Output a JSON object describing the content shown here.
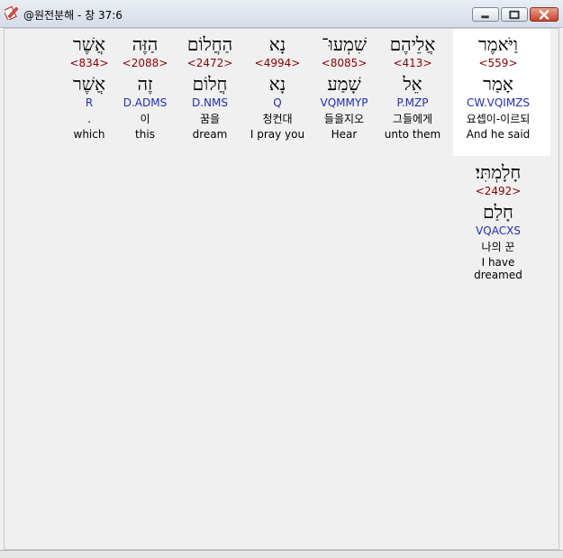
{
  "window": {
    "title": "@원전분해 - 창 37:6",
    "icon": "app-icon",
    "buttons": [
      "minimize",
      "maximize",
      "close"
    ]
  },
  "colors": {
    "strong": "#8b0000",
    "morph": "#1f2fb0",
    "highlight": "#ffffff"
  },
  "words": [
    {
      "heb": "וַיֹּאמֶר",
      "strong": "<559>",
      "lemma": "אָמַר",
      "morph": "CW.VQIMZS",
      "kor": "요셉이-이르되",
      "eng": "And he said"
    },
    {
      "heb": "אֲלֵיהֶם",
      "strong": "<413>",
      "lemma": "אֵל",
      "morph": "P.MZP",
      "kor": "그들에게",
      "eng": "unto them"
    },
    {
      "heb": "שִׁמְעוּ־",
      "strong": "<8085>",
      "lemma": "שָׁמַע",
      "morph": "VQMMYP",
      "kor": "들을지오",
      "eng": "Hear"
    },
    {
      "heb": "נָא",
      "strong": "<4994>",
      "lemma": "נָא",
      "morph": "Q",
      "kor": "청컨대",
      "eng": "I pray you"
    },
    {
      "heb": "הַחֲלוֹם",
      "strong": "<2472>",
      "lemma": "חֲלוֹם",
      "morph": "D.NMS",
      "kor": "꿈을",
      "eng": "dream"
    },
    {
      "heb": "הַזֶּה",
      "strong": "<2088>",
      "lemma": "זֶה",
      "morph": "D.ADMS",
      "kor": "이",
      "eng": "this"
    },
    {
      "heb": "אֲשֶׁר",
      "strong": "<834>",
      "lemma": "אֲשֶׁר",
      "morph": "R",
      "kor": ".",
      "eng": "which"
    },
    {
      "heb": "חָלָמְתִּי׃",
      "strong": "<2492>",
      "lemma": "חָלַם",
      "morph": "VQACXS",
      "kor": "나의 꾼",
      "eng": "I have dreamed"
    }
  ]
}
